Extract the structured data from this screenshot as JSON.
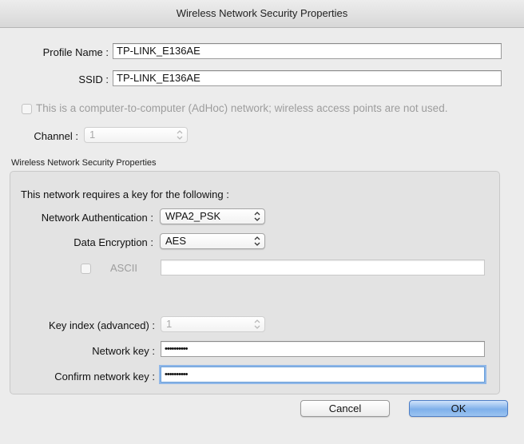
{
  "window": {
    "title": "Wireless Network Security Properties"
  },
  "profile": {
    "label": "Profile Name :",
    "value": "TP-LINK_E136AE"
  },
  "ssid": {
    "label": "SSID :",
    "value": "TP-LINK_E136AE"
  },
  "adhoc": {
    "label": "This is a computer-to-computer (AdHoc) network; wireless access points are not used.",
    "checked": false
  },
  "channel": {
    "label": "Channel :",
    "value": "1"
  },
  "security_group": {
    "title": "Wireless Network Security Properties",
    "intro": "This network requires a key for the following :",
    "auth": {
      "label": "Network Authentication :",
      "value": "WPA2_PSK"
    },
    "encryption": {
      "label": "Data Encryption :",
      "value": "AES"
    },
    "ascii": {
      "label": "ASCII",
      "value": "",
      "checked": false
    },
    "key_index": {
      "label": "Key index (advanced) :",
      "value": "1"
    },
    "network_key": {
      "label": "Network key :",
      "value": "••••••••••"
    },
    "confirm_key": {
      "label": "Confirm network key :",
      "value": "••••••••••"
    }
  },
  "buttons": {
    "cancel": "Cancel",
    "ok": "OK"
  },
  "colors": {
    "default_button": "#7fb0ea",
    "focus_ring": "#8fb7e8",
    "window_bg": "#ececec"
  }
}
